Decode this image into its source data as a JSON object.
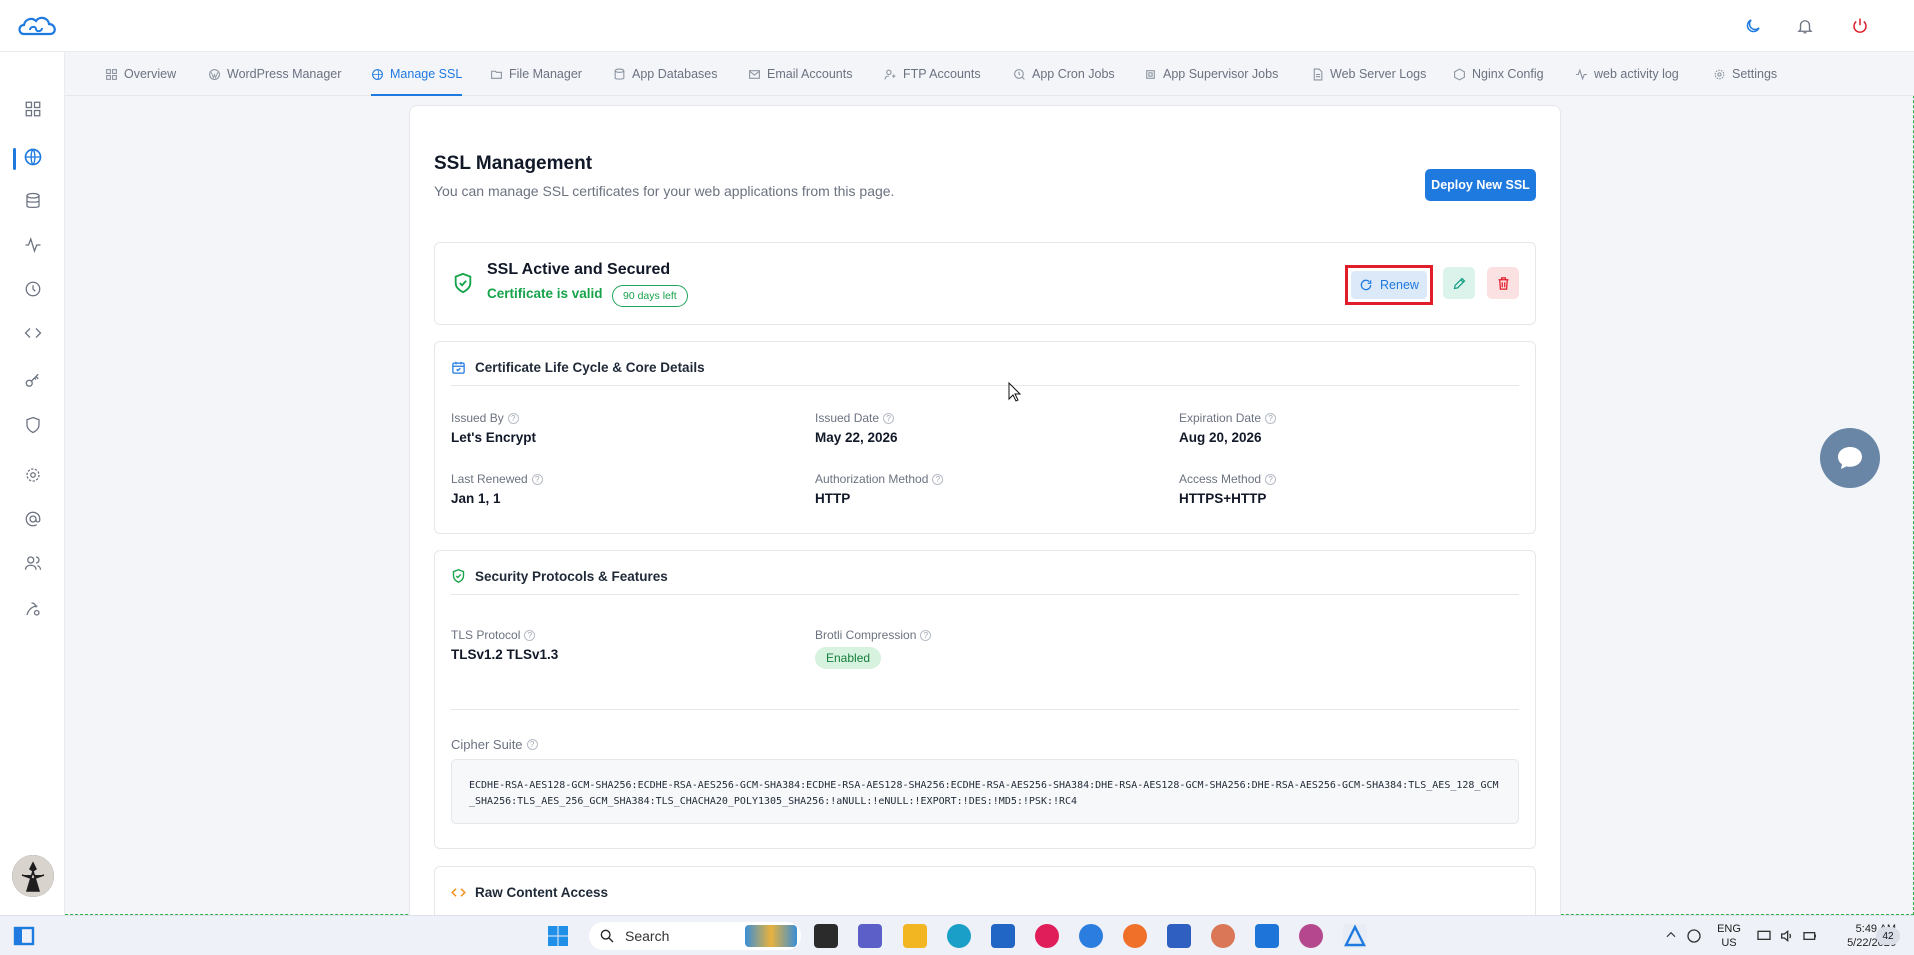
{
  "app": {
    "logo": "cloud-logo"
  },
  "header_icons": [
    "moon-icon",
    "bell-icon",
    "power-icon"
  ],
  "tabs": [
    {
      "label": "Overview",
      "icon": "grid-icon"
    },
    {
      "label": "WordPress Manager",
      "icon": "wordpress-icon"
    },
    {
      "label": "Manage SSL",
      "icon": "globe-lock-icon",
      "active": true
    },
    {
      "label": "File Manager",
      "icon": "folder-icon"
    },
    {
      "label": "App Databases",
      "icon": "database-icon"
    },
    {
      "label": "Email Accounts",
      "icon": "mail-icon"
    },
    {
      "label": "FTP Accounts",
      "icon": "user-key-icon"
    },
    {
      "label": "App Cron Jobs",
      "icon": "clock-search-icon"
    },
    {
      "label": "App Supervisor Jobs",
      "icon": "cpu-icon"
    },
    {
      "label": "Web Server Logs",
      "icon": "file-icon"
    },
    {
      "label": "Nginx Config",
      "icon": "hexagon-icon"
    },
    {
      "label": "web activity log",
      "icon": "activity-icon"
    },
    {
      "label": "Settings",
      "icon": "gear-icon"
    }
  ],
  "sidebar": {
    "items": [
      "dashboard-icon",
      "globe-icon",
      "database-icon",
      "activity-icon",
      "clock-icon",
      "code-icon",
      "key-icon",
      "shield-icon",
      "settings-icon",
      "at-icon",
      "users-icon",
      "user-gear-icon"
    ],
    "active_index": 1
  },
  "page": {
    "title": "SSL Management",
    "subtitle": "You can manage SSL certificates for your web applications from this page.",
    "deploy_button": "Deploy New SSL"
  },
  "status": {
    "title": "SSL Active and Secured",
    "valid_text": "Certificate is valid",
    "days_left": "90 days left",
    "renew_label": "Renew"
  },
  "lifecycle": {
    "heading": "Certificate Life Cycle & Core Details",
    "fields": [
      {
        "label": "Issued By",
        "value": "Let's Encrypt"
      },
      {
        "label": "Issued Date",
        "value": "May 22, 2026"
      },
      {
        "label": "Expiration Date",
        "value": "Aug 20, 2026"
      },
      {
        "label": "Last Renewed",
        "value": "Jan 1, 1"
      },
      {
        "label": "Authorization Method",
        "value": "HTTP"
      },
      {
        "label": "Access Method",
        "value": "HTTPS+HTTP"
      }
    ]
  },
  "security": {
    "heading": "Security Protocols & Features",
    "tls_label": "TLS Protocol",
    "tls_value": "TLSv1.2 TLSv1.3",
    "brotli_label": "Brotli Compression",
    "brotli_value": "Enabled",
    "cipher_label": "Cipher Suite",
    "cipher_value": "ECDHE-RSA-AES128-GCM-SHA256:ECDHE-RSA-AES256-GCM-SHA384:ECDHE-RSA-AES128-SHA256:ECDHE-RSA-AES256-SHA384:DHE-RSA-AES128-GCM-SHA256:DHE-RSA-AES256-GCM-SHA384:TLS_AES_128_GCM_SHA256:TLS_AES_256_GCM_SHA384:TLS_CHACHA20_POLY1305_SHA256:!aNULL:!eNULL:!EXPORT:!DES:!MD5:!PSK:!RC4"
  },
  "raw": {
    "heading": "Raw Content Access"
  },
  "taskbar": {
    "search_label": "Search",
    "lang_top": "ENG",
    "lang_bottom": "US",
    "time": "5:49 AM",
    "date": "5/22/2026",
    "notification_count": "42"
  },
  "colors": {
    "accent": "#1f7ae0",
    "success": "#16a34a",
    "danger": "#e11d2a"
  }
}
